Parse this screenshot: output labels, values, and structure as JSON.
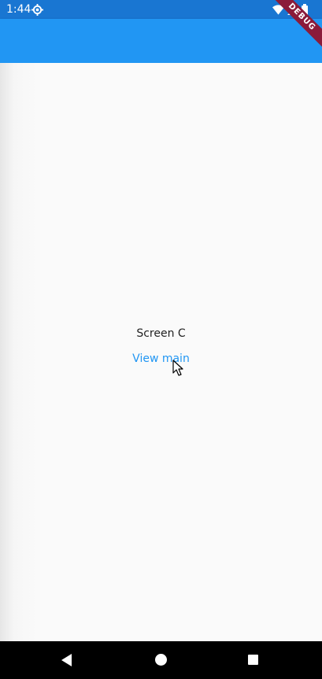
{
  "status_bar": {
    "time": "1:44",
    "icons": [
      "settings-icon",
      "wifi-icon",
      "signal-icon",
      "battery-icon"
    ]
  },
  "debug_banner": {
    "label": "DEBUG"
  },
  "main": {
    "screen_label": "Screen C",
    "view_main_label": "View main"
  },
  "nav_bar": {
    "icons": [
      "back-icon",
      "home-icon",
      "recents-icon"
    ]
  },
  "colors": {
    "status_bar": "#1976d2",
    "app_bar": "#2196f3",
    "link": "#2196f3",
    "debug_ribbon": "#8b1b3a",
    "nav_bar": "#000000"
  }
}
